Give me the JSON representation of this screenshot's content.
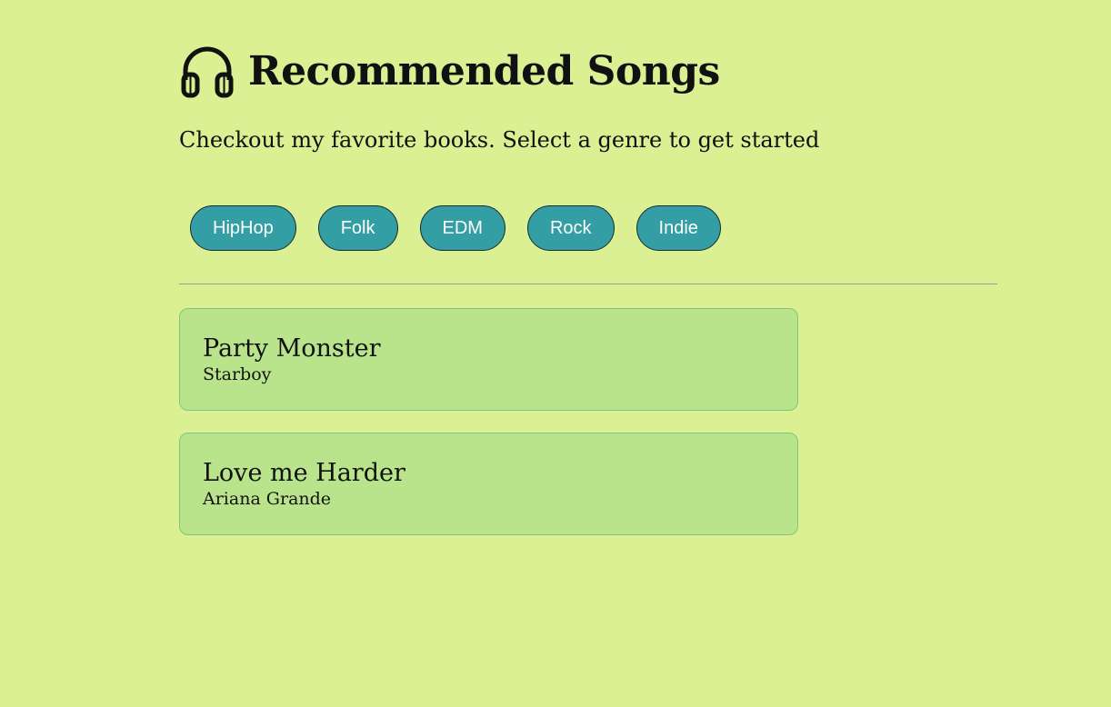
{
  "header": {
    "title": "Recommended Songs",
    "icon": "headphones-icon",
    "subtitle": "Checkout my favorite books. Select a genre to get started"
  },
  "genres": [
    {
      "label": "HipHop"
    },
    {
      "label": "Folk"
    },
    {
      "label": "EDM"
    },
    {
      "label": "Rock"
    },
    {
      "label": "Indie"
    }
  ],
  "songs": [
    {
      "title": "Party Monster",
      "artist": "Starboy"
    },
    {
      "title": "Love me Harder",
      "artist": "Ariana Grande"
    }
  ],
  "colors": {
    "background": "#dbef93",
    "genre_button": "#339fa4",
    "card": "#b9e48b",
    "card_border": "#7ec67a"
  }
}
